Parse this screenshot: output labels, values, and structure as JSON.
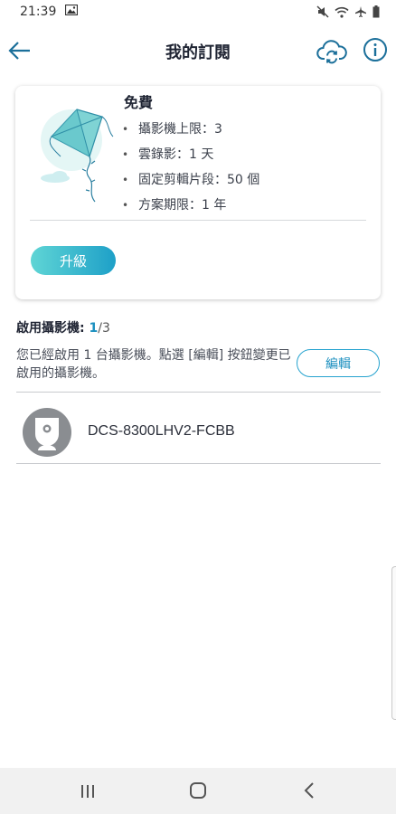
{
  "status_bar": {
    "time": "21:39"
  },
  "header": {
    "title": "我的訂閱"
  },
  "plan": {
    "name": "免費",
    "features": [
      "攝影機上限：3",
      "雲錄影：1 天",
      "固定剪輯片段：50 個",
      "方案期限：1 年"
    ],
    "bullet": "•",
    "upgrade_label": "升級"
  },
  "enabled": {
    "title": "啟用攝影機:",
    "count": "1",
    "total": "/3",
    "description": "您已經啟用 1 台攝影機。點選 [編輯] 按鈕變更已啟用的攝影機。",
    "edit_label": "編輯"
  },
  "cameras": [
    {
      "name": "DCS-8300LHV2-FCBB"
    }
  ],
  "colors": {
    "accent": "#1b8fbf",
    "upgrade_gradient_start": "#5fd5d5",
    "upgrade_gradient_end": "#1ea0c8",
    "avatar_bg": "#8a8d91"
  },
  "icons": {
    "status": [
      "image-icon",
      "mute-icon",
      "wifi-icon",
      "airplane-icon",
      "battery-icon"
    ],
    "header": [
      "back-arrow-icon",
      "cloud-sync-icon",
      "info-icon"
    ],
    "nav": [
      "recent-apps-icon",
      "home-icon",
      "nav-back-icon"
    ]
  }
}
